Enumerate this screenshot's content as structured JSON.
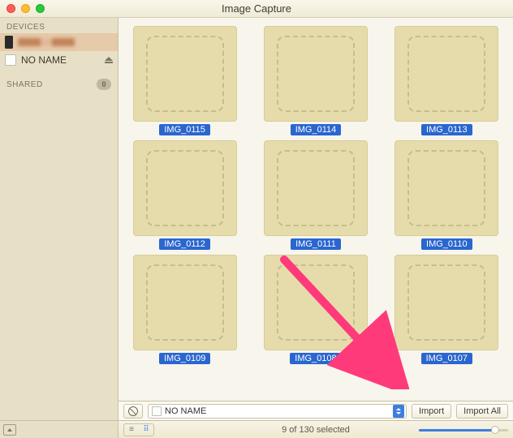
{
  "window": {
    "title": "Image Capture"
  },
  "sidebar": {
    "devices_header": "DEVICES",
    "shared_header": "SHARED",
    "shared_count": "0",
    "items": [
      {
        "label": "(phone)"
      },
      {
        "label": "NO NAME"
      }
    ]
  },
  "thumbnails": [
    {
      "name": "IMG_0115"
    },
    {
      "name": "IMG_0114"
    },
    {
      "name": "IMG_0113"
    },
    {
      "name": "IMG_0112"
    },
    {
      "name": "IMG_0111"
    },
    {
      "name": "IMG_0110"
    },
    {
      "name": "IMG_0109"
    },
    {
      "name": "IMG_0108"
    },
    {
      "name": "IMG_0107"
    }
  ],
  "toolbar": {
    "destination": "NO NAME",
    "import_label": "Import",
    "import_all_label": "Import All"
  },
  "status": {
    "text": "9 of 130 selected"
  }
}
